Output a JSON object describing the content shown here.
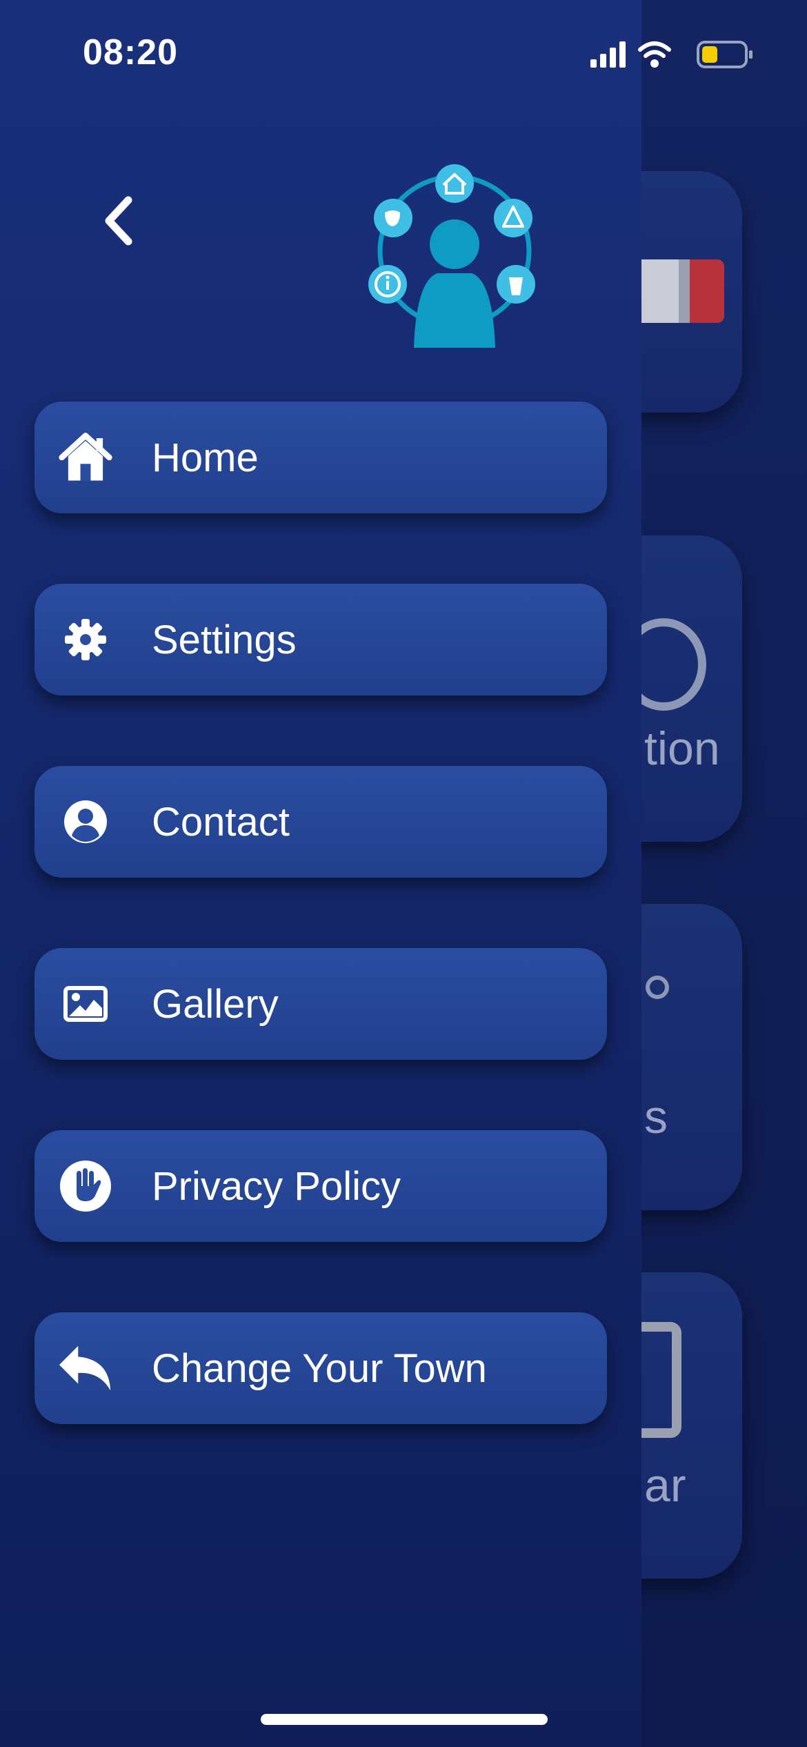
{
  "status_bar": {
    "time": "08:20",
    "battery_color": "#f5cc00"
  },
  "drawer": {
    "back_icon": "chevron-left-icon",
    "logo_icon": "town-services-person-icon",
    "menu": [
      {
        "label": "Home",
        "icon": "home-icon"
      },
      {
        "label": "Settings",
        "icon": "gear-icon"
      },
      {
        "label": "Contact",
        "icon": "user-circle-icon"
      },
      {
        "label": "Gallery",
        "icon": "image-icon"
      },
      {
        "label": "Privacy Policy",
        "icon": "hand-stop-icon"
      },
      {
        "label": "Change Your Town",
        "icon": "reply-arrow-icon"
      }
    ]
  },
  "background_page": {
    "cards": [
      {
        "label": ""
      },
      {
        "label": "tion"
      },
      {
        "label": "s"
      },
      {
        "label": "ar"
      }
    ]
  },
  "colors": {
    "drawer_bg": "#1a307c",
    "menu_button": "#2b4da0",
    "logo_accent": "#0e9cc4",
    "flag_red": "#b8323c"
  }
}
